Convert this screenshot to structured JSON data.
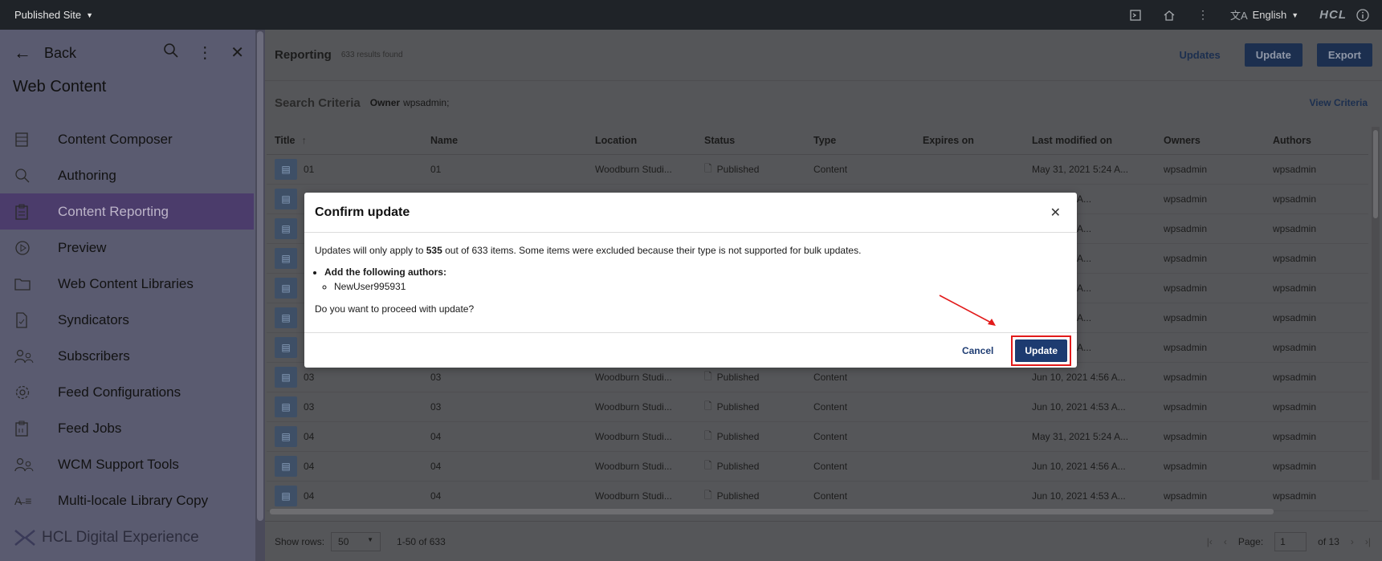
{
  "topbar": {
    "site": "Published Site",
    "language": "English",
    "brand": "HCL"
  },
  "sidebar": {
    "back": "Back",
    "title": "Web Content",
    "items": [
      {
        "label": "Content Composer",
        "icon": "composer-icon"
      },
      {
        "label": "Authoring",
        "icon": "search-icon"
      },
      {
        "label": "Content Reporting",
        "icon": "clipboard-icon",
        "active": true
      },
      {
        "label": "Preview",
        "icon": "play-icon"
      },
      {
        "label": "Web Content Libraries",
        "icon": "folder-icon"
      },
      {
        "label": "Syndicators",
        "icon": "document-check-icon"
      },
      {
        "label": "Subscribers",
        "icon": "users-icon"
      },
      {
        "label": "Feed Configurations",
        "icon": "gear-icon"
      },
      {
        "label": "Feed Jobs",
        "icon": "clipboard-list-icon"
      },
      {
        "label": "WCM Support Tools",
        "icon": "users-icon"
      },
      {
        "label": "Multi-locale Library Copy",
        "icon": "translate-icon"
      }
    ],
    "brand": "HCL Digital Experience"
  },
  "report": {
    "title": "Reporting",
    "count": "633 results found",
    "actions": {
      "updates": "Updates",
      "update": "Update",
      "export": "Export"
    },
    "criteria_label": "Search Criteria",
    "criteria_owner_key": "Owner",
    "criteria_owner_value": "wpsadmin;",
    "view_criteria": "View Criteria",
    "columns": [
      "Title",
      "Name",
      "Location",
      "Status",
      "Type",
      "Expires on",
      "Last modified on",
      "Owners",
      "Authors"
    ],
    "rows": [
      {
        "title": "01",
        "name": "01",
        "location": "Woodburn Studi...",
        "status": "Published",
        "type": "Content",
        "expires": "",
        "modified": "May 31, 2021 5:24 A...",
        "owner": "wpsadmin",
        "author": "wpsadmin"
      },
      {
        "title": "",
        "name": "",
        "location": "",
        "status": "",
        "type": "",
        "expires": "",
        "modified": "2021 4:56 A...",
        "owner": "wpsadmin",
        "author": "wpsadmin"
      },
      {
        "title": "",
        "name": "",
        "location": "",
        "status": "",
        "type": "",
        "expires": "",
        "modified": "2021 4:53 A...",
        "owner": "wpsadmin",
        "author": "wpsadmin"
      },
      {
        "title": "",
        "name": "",
        "location": "",
        "status": "",
        "type": "",
        "expires": "",
        "modified": "2021 5:24 A...",
        "owner": "wpsadmin",
        "author": "wpsadmin"
      },
      {
        "title": "",
        "name": "",
        "location": "",
        "status": "",
        "type": "",
        "expires": "",
        "modified": "2021 4:56 A...",
        "owner": "wpsadmin",
        "author": "wpsadmin"
      },
      {
        "title": "",
        "name": "",
        "location": "",
        "status": "",
        "type": "",
        "expires": "",
        "modified": "2021 4:53 A...",
        "owner": "wpsadmin",
        "author": "wpsadmin"
      },
      {
        "title": "",
        "name": "",
        "location": "",
        "status": "",
        "type": "",
        "expires": "",
        "modified": "2021 5:24 A...",
        "owner": "wpsadmin",
        "author": "wpsadmin"
      },
      {
        "title": "03",
        "name": "03",
        "location": "Woodburn Studi...",
        "status": "Published",
        "type": "Content",
        "expires": "",
        "modified": "Jun 10, 2021 4:56 A...",
        "owner": "wpsadmin",
        "author": "wpsadmin"
      },
      {
        "title": "03",
        "name": "03",
        "location": "Woodburn Studi...",
        "status": "Published",
        "type": "Content",
        "expires": "",
        "modified": "Jun 10, 2021 4:53 A...",
        "owner": "wpsadmin",
        "author": "wpsadmin"
      },
      {
        "title": "04",
        "name": "04",
        "location": "Woodburn Studi...",
        "status": "Published",
        "type": "Content",
        "expires": "",
        "modified": "May 31, 2021 5:24 A...",
        "owner": "wpsadmin",
        "author": "wpsadmin"
      },
      {
        "title": "04",
        "name": "04",
        "location": "Woodburn Studi...",
        "status": "Published",
        "type": "Content",
        "expires": "",
        "modified": "Jun 10, 2021 4:56 A...",
        "owner": "wpsadmin",
        "author": "wpsadmin"
      },
      {
        "title": "04",
        "name": "04",
        "location": "Woodburn Studi...",
        "status": "Published",
        "type": "Content",
        "expires": "",
        "modified": "Jun 10, 2021 4:53 A...",
        "owner": "wpsadmin",
        "author": "wpsadmin"
      }
    ],
    "footer": {
      "show_rows": "Show rows:",
      "rows_value": "50",
      "range": "1-50 of 633",
      "page_label": "Page:",
      "page_value": "1",
      "of_pages": "of 13"
    }
  },
  "modal": {
    "title": "Confirm update",
    "msg_prefix": "Updates will only apply to ",
    "msg_bold": "535",
    "msg_suffix": " out of 633 items. Some items were excluded because their type is not supported for bulk updates.",
    "list_heading": "Add the following authors:",
    "list_item": "NewUser995931",
    "question": "Do you want to proceed with update?",
    "cancel": "Cancel",
    "update": "Update"
  },
  "colors": {
    "highlight": "#e21b1b",
    "primary": "#1d3b70",
    "active_nav": "#4b3c6b"
  }
}
